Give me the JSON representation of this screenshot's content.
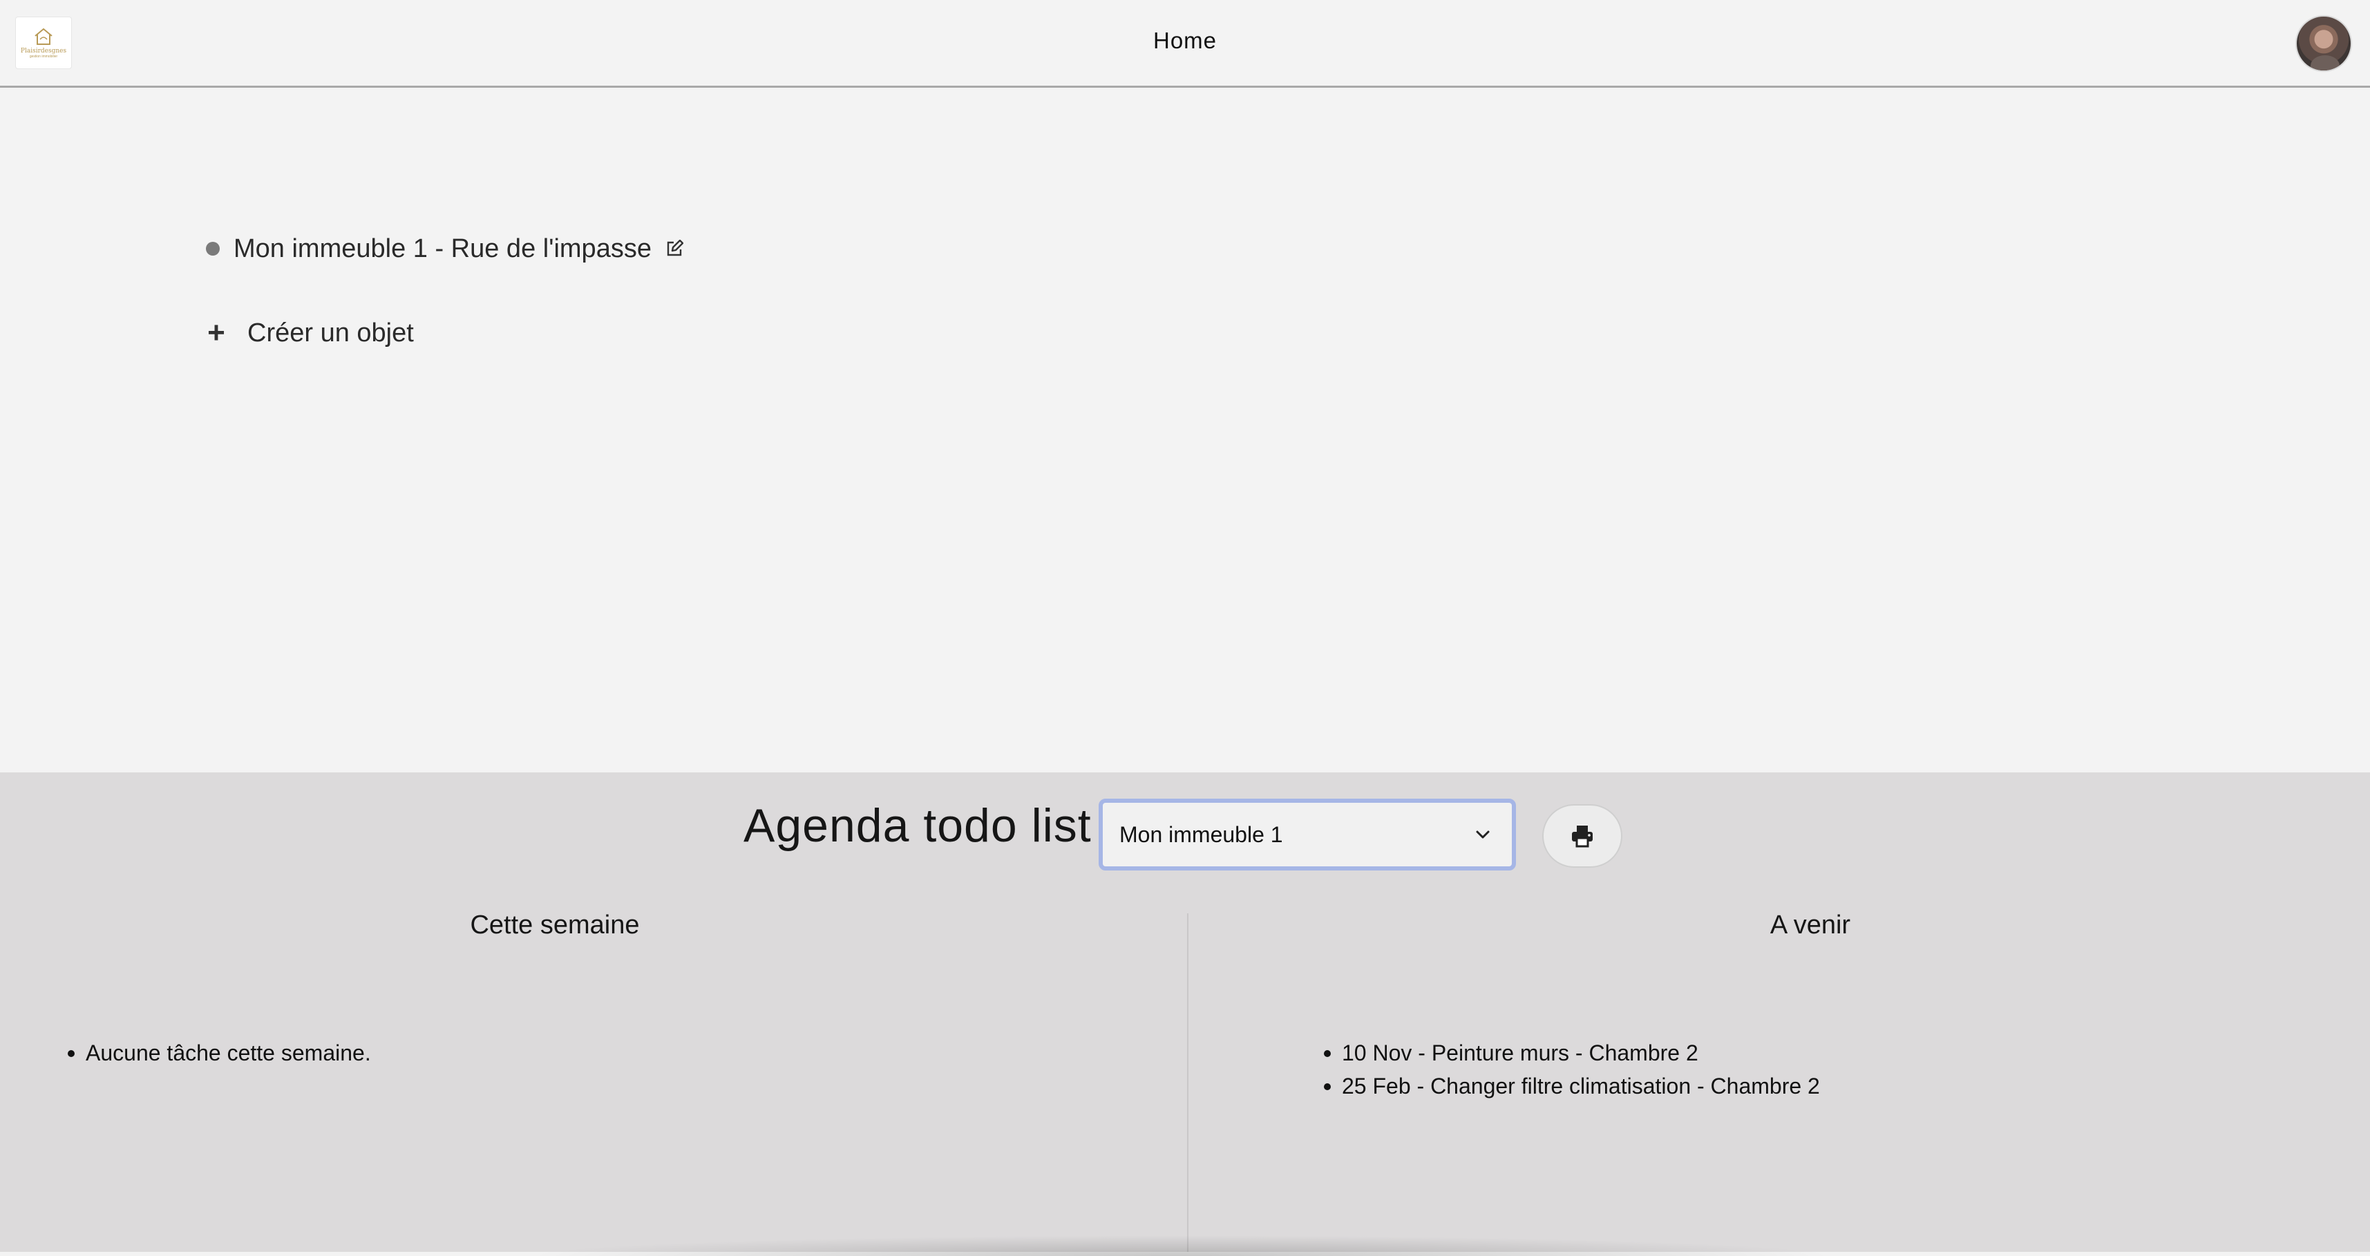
{
  "header": {
    "logo_text": "Plaisirdesgnes",
    "logo_subtext": "gestion immobilier",
    "title": "Home"
  },
  "main": {
    "buildings": [
      {
        "label": "Mon immeuble 1 - Rue de l'impasse"
      }
    ],
    "create_label": "Créer un objet",
    "create_icon": "+"
  },
  "agenda": {
    "title": "Agenda todo list",
    "select": {
      "selected": "Mon immeuble 1"
    },
    "this_week": {
      "heading": "Cette semaine",
      "items": [
        "Aucune tâche cette semaine."
      ]
    },
    "upcoming": {
      "heading": "A venir",
      "items": [
        "10 Nov - Peinture murs - Chambre 2",
        "25 Feb - Changer filtre climatisation - Chambre 2"
      ]
    }
  },
  "icons": {
    "logo": "house-icon",
    "edit": "edit-icon",
    "chevron": "chevron-down-icon",
    "print": "printer-icon"
  },
  "colors": {
    "page_background": "#f3f3f3",
    "agenda_background": "#dcdadb",
    "select_focus_border": "#a6b6e6",
    "logo_gold": "#b89a56"
  }
}
